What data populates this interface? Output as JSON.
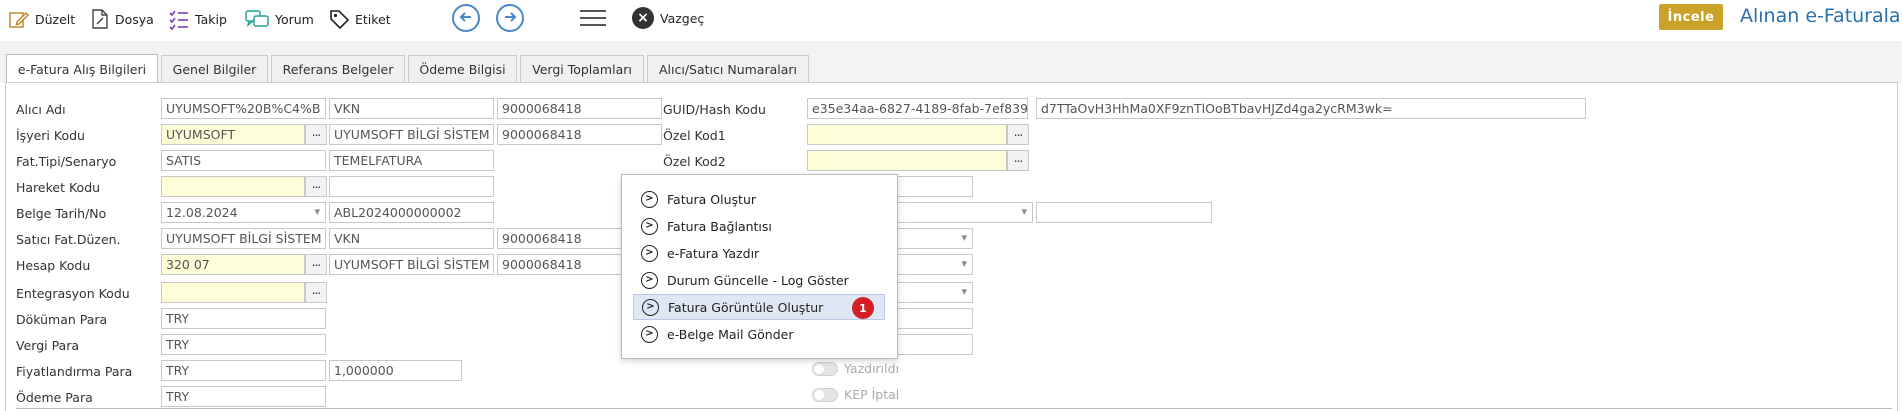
{
  "toolbar": {
    "edit_label": "Düzelt",
    "file_label": "Dosya",
    "track_label": "Takip",
    "comment_label": "Yorum",
    "tag_label": "Etiket",
    "cancel_label": "Vazgeç",
    "inspect_label": "İncele",
    "accent_color": "#4a88c7",
    "inspect_color": "#c9a227"
  },
  "page_title": "Alınan e-Faturalar",
  "tabs": [
    {
      "label": "e-Fatura Alış Bilgileri",
      "active": true
    },
    {
      "label": "Genel Bilgiler",
      "active": false
    },
    {
      "label": "Referans Belgeler",
      "active": false
    },
    {
      "label": "Ödeme Bilgisi",
      "active": false
    },
    {
      "label": "Vergi Toplamları",
      "active": false
    },
    {
      "label": "Alıcı/Satıcı Numaraları",
      "active": false
    }
  ],
  "form": {
    "alici_adi": {
      "label": "Alıcı Adı",
      "v1": "UYUMSOFT%20B%C4%B",
      "v2": "VKN",
      "v3": "9000068418"
    },
    "isyeri_kodu": {
      "label": "İşyeri Kodu",
      "v1": "UYUMSOFT",
      "v2": "UYUMSOFT BİLGİ SİSTEM",
      "v3": "9000068418"
    },
    "fat_tipi": {
      "label": "Fat.Tipi/Senaryo",
      "v1": "SATIS",
      "v2": "TEMELFATURA"
    },
    "hareket_kodu": {
      "label": "Hareket Kodu",
      "v1": "",
      "v2": ""
    },
    "belge_tarih": {
      "label": "Belge Tarih/No",
      "v1": "12.08.2024",
      "v2": "ABL2024000000002"
    },
    "satici_fat": {
      "label": "Satıcı Fat.Düzen.",
      "v1": "UYUMSOFT BİLGİ SİSTEM",
      "v2": "VKN",
      "v3": "9000068418"
    },
    "hesap_kodu": {
      "label": "Hesap Kodu",
      "v1": "320 07",
      "v2": "UYUMSOFT BİLGİ SİSTEM",
      "v3": "9000068418"
    },
    "entegrasyon_kodu": {
      "label": "Entegrasyon Kodu",
      "v1": ""
    },
    "dokuman_para": {
      "label": "Döküman Para",
      "v1": "TRY"
    },
    "vergi_para": {
      "label": "Vergi Para",
      "v1": "TRY"
    },
    "fiyatlandirma_para": {
      "label": "Fiyatlandırma Para",
      "v1": "TRY",
      "v2": "1,000000"
    },
    "odeme_para": {
      "label": "Ödeme Para",
      "v1": "TRY"
    },
    "guid": {
      "label": "GUID/Hash Kodu",
      "v1": "e35e34aa-6827-4189-8fab-7ef839",
      "v2": "d7TTaOvH3HhMa0XF9znTlOoBTbavHJZd4ga2ycRM3wk="
    },
    "ozel_kod1": {
      "label": "Özel Kod1",
      "v1": ""
    },
    "ozel_kod2": {
      "label": "Özel Kod2",
      "v1": ""
    },
    "yazdirildi_label": "Yazdırıldı",
    "kep_iptal_label": "KEP İptal"
  },
  "popup": {
    "items": [
      {
        "label": "Fatura Oluştur"
      },
      {
        "label": "Fatura Bağlantısı"
      },
      {
        "label": "e-Fatura Yazdır"
      },
      {
        "label": "Durum Güncelle - Log Göster"
      },
      {
        "label": "Fatura Görüntüle Oluştur",
        "highlighted": true,
        "badge": "1"
      },
      {
        "label": "e-Belge Mail Gönder"
      }
    ]
  }
}
